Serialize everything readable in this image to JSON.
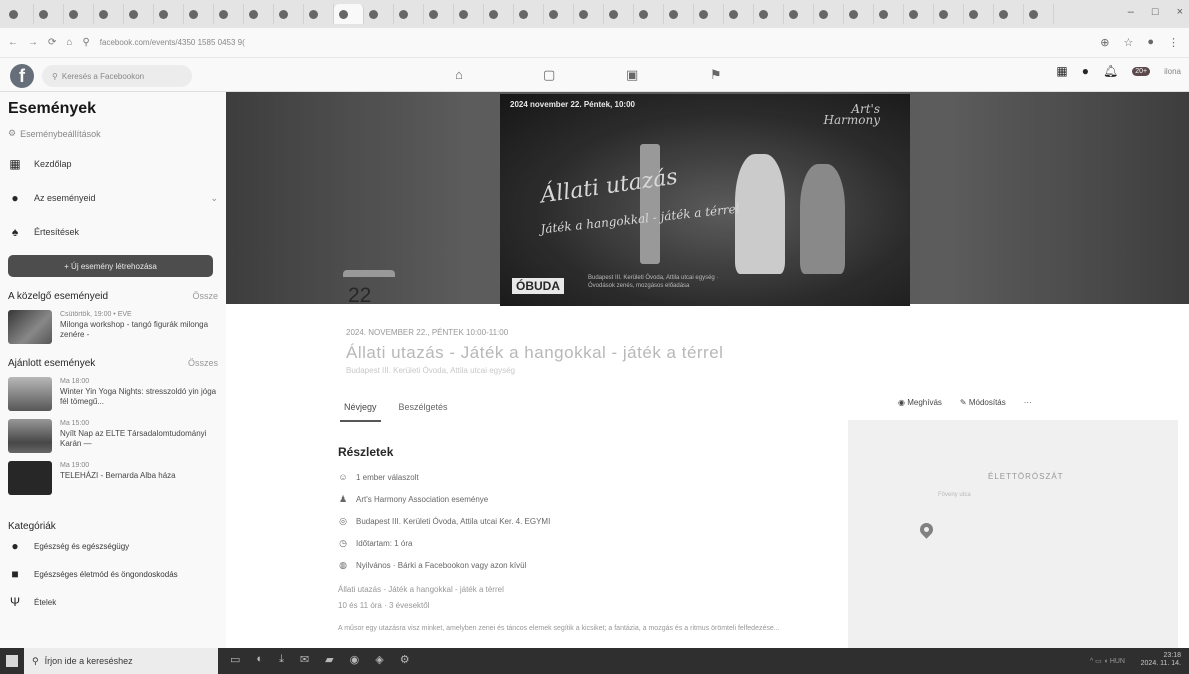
{
  "browser": {
    "url": "facebook.com/events/4350 1585 0453 9(",
    "tabs": [
      "",
      "",
      "",
      "",
      "",
      "",
      "",
      "",
      "",
      "",
      "",
      "",
      "",
      "",
      "",
      "",
      "",
      "",
      "",
      "",
      "",
      "",
      "",
      "",
      "",
      "",
      "",
      "",
      "",
      "",
      "",
      "",
      "",
      "",
      ""
    ],
    "win_min": "–",
    "win_max": "□",
    "win_close": "×"
  },
  "fb": {
    "search_placeholder": "Keresés a Facebookon",
    "notif_count": "20+",
    "user_tail": "ilona"
  },
  "sidebar": {
    "title": "Események",
    "settings": "Eseménybeállítások",
    "items": [
      {
        "label": "Kezdőlap",
        "icon": "calendar-icon"
      },
      {
        "label": "Az eseményeid",
        "icon": "person-icon"
      },
      {
        "label": "Értesítések",
        "icon": "bell-icon"
      }
    ],
    "create_button": "+ Új esemény létrehozása",
    "upcoming_title": "A közelgő eseményeid",
    "upcoming_more": "Össze",
    "upcoming": [
      {
        "date": "Csütörtök, 19:00 • EVE",
        "title": "Milonga workshop - tangó figurák milonga zenére -"
      }
    ],
    "suggested_title": "Ajánlott események",
    "suggested_more": "Összes",
    "suggested": [
      {
        "date": "Ma 18:00",
        "title": "Winter Yin Yoga Nights: stresszoldó yin jóga fél tömegű..."
      },
      {
        "date": "Ma 15:00",
        "title": "Nyílt Nap az ELTE Társadalomtudományi Karán —"
      },
      {
        "date": "Ma 19:00",
        "title": "TELEHÁZI - Bernarda Alba háza"
      }
    ],
    "categories_title": "Kategóriák",
    "categories": [
      {
        "label": "Egészség és egészségügy",
        "icon": "health-icon"
      },
      {
        "label": "Egészséges életmód és öngondoskodás",
        "icon": "wellness-icon"
      },
      {
        "label": "Ételek",
        "icon": "food-icon"
      }
    ]
  },
  "poster": {
    "date": "2024 november 22. Péntek, 10:00",
    "brand_line1": "Art's",
    "brand_line2": "Harmony",
    "title": "Állati utazás",
    "subtitle": "Játék a hangokkal - játék a térrel",
    "logo": "ÓBUDA",
    "info": "Budapest III. Kerületi Óvoda, Attila utcai egység · Óvodások zenés, mozgásos előadása"
  },
  "event": {
    "day": "22",
    "datetime": "2024. NOVEMBER 22., PÉNTEK 10:00-11:00",
    "title": "Állati utazás - Játék a hangokkal - játék a térrel",
    "subline": "Budapest III. Kerületi Óvoda, Attila utcai egység",
    "tabs": [
      "Névjegy",
      "Beszélgetés"
    ],
    "action_share": "Meghívás",
    "action_edit": "Módosítás",
    "action_more": "···",
    "details_title": "Részletek",
    "details": [
      {
        "icon": "people-icon",
        "text": "1 ember válaszolt"
      },
      {
        "icon": "user-icon",
        "text": "Art's Harmony Association eseménye"
      },
      {
        "icon": "location-icon",
        "text": "Budapest III. Kerületi Óvoda, Attila utcai Ker. 4. EGYMI"
      },
      {
        "icon": "clock-icon",
        "text": "Időtartam: 1 óra"
      },
      {
        "icon": "globe-icon",
        "text": "Nyilvános · Bárki a Facebookon vagy azon kívül"
      }
    ],
    "desc1": "Állati utazás - Játék a hangokkal - játék a térrel",
    "desc2": "10 és 11 óra · 3 évesektől",
    "desc3": "A műsor egy utazásra visz minket, amelyben zenei és táncos elemek segítik a kicsiket; a fantázia, a mozgás és a ritmus örömteli felfedezése..."
  },
  "map": {
    "label": "ÉLETTÖRÓSZÁT",
    "road": "Föveny utca"
  },
  "taskbar": {
    "search": "Írjon ide a kereséshez",
    "tray": "23:18",
    "tray_date": "2024. 11. 14."
  }
}
